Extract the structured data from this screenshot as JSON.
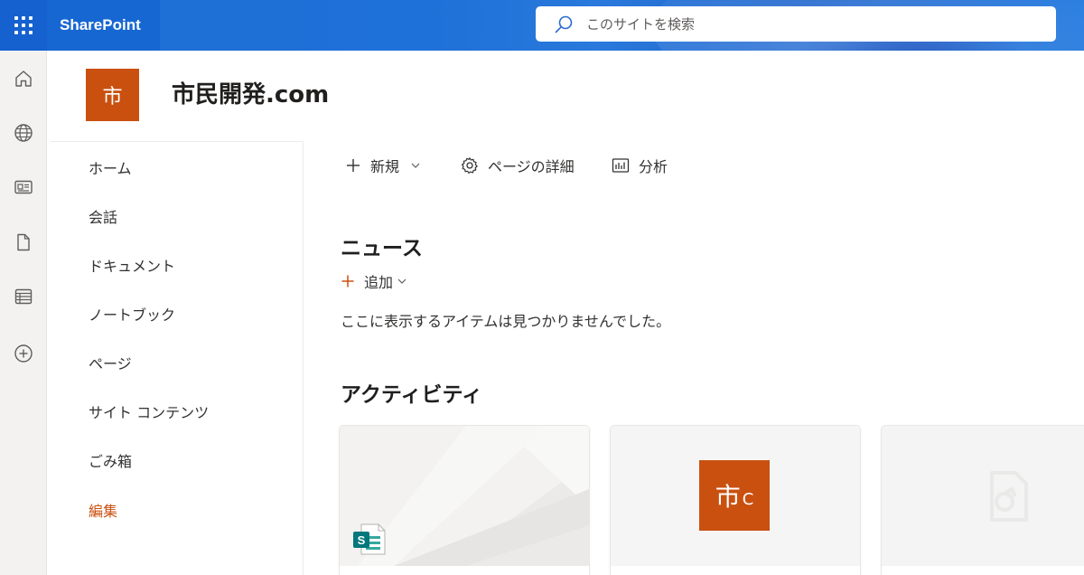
{
  "suite": {
    "brand": "SharePoint",
    "search_placeholder": "このサイトを検索"
  },
  "appbar": {
    "apps": [
      {
        "icon": "home-icon"
      },
      {
        "icon": "globe-icon"
      },
      {
        "icon": "news-icon"
      },
      {
        "icon": "file-icon"
      },
      {
        "icon": "list-icon"
      },
      {
        "icon": "add-circle-icon"
      }
    ]
  },
  "site": {
    "logo_text": "市",
    "title": "市民開発.com",
    "accent_color": "#ca5010"
  },
  "nav": {
    "items": [
      {
        "label": "ホーム"
      },
      {
        "label": "会話"
      },
      {
        "label": "ドキュメント"
      },
      {
        "label": "ノートブック"
      },
      {
        "label": "ページ"
      },
      {
        "label": "サイト コンテンツ"
      },
      {
        "label": "ごみ箱"
      },
      {
        "label": "編集"
      }
    ]
  },
  "commandbar": {
    "new_label": "新規",
    "page_details_label": "ページの詳細",
    "analytics_label": "分析"
  },
  "news": {
    "heading": "ニュース",
    "add_label": "追加",
    "empty_message": "ここに表示するアイテムは見つかりませんでした。"
  },
  "activity": {
    "heading": "アクティビティ",
    "cards": [
      {
        "thumb": "sharepoint-page-icon"
      },
      {
        "thumb_big": "市",
        "thumb_small": "C"
      },
      {
        "thumb": "placeholder-file-icon"
      }
    ]
  }
}
